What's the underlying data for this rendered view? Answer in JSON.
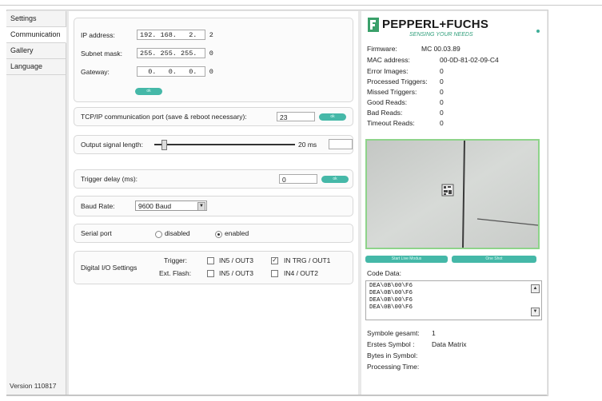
{
  "sidebar": {
    "items": [
      {
        "label": "Settings"
      },
      {
        "label": "Communication"
      },
      {
        "label": "Gallery"
      },
      {
        "label": "Language"
      }
    ],
    "version": "Version 110817"
  },
  "network": {
    "ip_label": "IP address:",
    "ip_value": "192. 168.   2.   2",
    "subnet_label": "Subnet mask:",
    "subnet_value": "255. 255. 255.   0",
    "gateway_label": "Gateway:",
    "gateway_value": "  0.   0.   0.   0",
    "ok_label": "ok"
  },
  "tcp": {
    "label": "TCP/IP communication port (save & reboot necessary):",
    "value": "23",
    "ok_label": "ok"
  },
  "output_signal": {
    "label": "Output signal length:",
    "value_text": "20 ms",
    "slider_fraction": 0.05
  },
  "trigger_delay": {
    "label": "Trigger delay (ms):",
    "value": "0",
    "ok_label": "ok"
  },
  "baud": {
    "label": "Baud Rate:",
    "selected": "9600 Baud"
  },
  "serial": {
    "label": "Serial port",
    "option_disabled": "disabled",
    "option_enabled": "enabled",
    "selected": "enabled"
  },
  "digital_io": {
    "label": "Digital I/O Settings",
    "trigger_label": "Trigger:",
    "flash_label": "Ext. Flash:",
    "trigger_opt1": "IN5 / OUT3",
    "trigger_opt2": "IN TRG / OUT1",
    "flash_opt1": "IN5 / OUT3",
    "flash_opt2": "IN4 / OUT2",
    "trigger_opt1_checked": false,
    "trigger_opt2_checked": true,
    "flash_opt1_checked": false,
    "flash_opt2_checked": false
  },
  "brand": {
    "name": "PEPPERL+FUCHS",
    "tagline": "SENSING YOUR NEEDS",
    "accent": "#3aa06a"
  },
  "device_info": [
    {
      "label": "Firmware:",
      "value": "MC 00.03.89"
    },
    {
      "label": "MAC address:",
      "value": "00-0D-81-02-09-C4"
    },
    {
      "label": "Error Images:",
      "value": "0"
    },
    {
      "label": "Processed Triggers:",
      "value": "0"
    },
    {
      "label": "Missed Triggers:",
      "value": "0"
    },
    {
      "label": "Good Reads:",
      "value": "0"
    },
    {
      "label": "Bad Reads:",
      "value": "0"
    },
    {
      "label": "Timeout Reads:",
      "value": "0"
    }
  ],
  "buttons": {
    "start_live": "Start Live Modus",
    "one_shot": "One Shot"
  },
  "code": {
    "label": "Code Data:",
    "lines": [
      "DEA\\0B\\00\\F6",
      "DEA\\0B\\00\\F6",
      "DEA\\0B\\00\\F6",
      "DEA\\0B\\00\\F6"
    ]
  },
  "symbol_info": {
    "total_label": "Symbole gesamt:",
    "total_value": "1",
    "first_label": "Erstes Symbol :",
    "first_value": "Data Matrix",
    "bytes_label": "Bytes in Symbol:",
    "bytes_value": "",
    "time_label": "Processing Time:",
    "time_value": ""
  }
}
